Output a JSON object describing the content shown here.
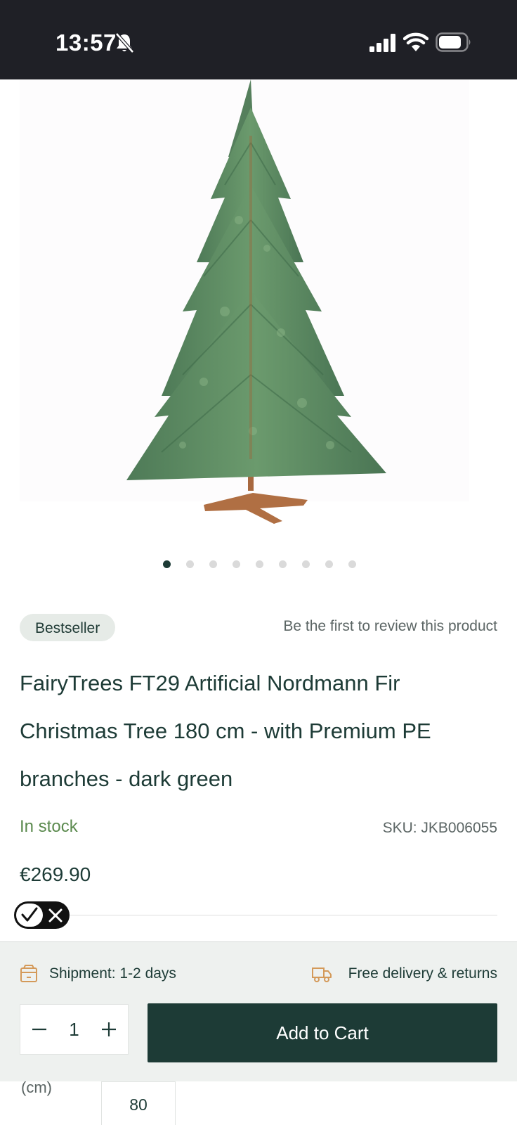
{
  "status_bar": {
    "time": "13:57",
    "icons": [
      "bell-slash-icon",
      "signal-icon",
      "wifi-icon",
      "battery-icon"
    ]
  },
  "gallery": {
    "image_description_icon": "christmas-tree-product-image",
    "dot_count": 9,
    "active_dot": 0
  },
  "product": {
    "badge": "Bestseller",
    "review_link": "Be the first to review this product",
    "title": "FairyTrees FT29 Artificial Nordmann Fir Christmas Tree 180 cm - with Premium PE branches - dark green",
    "stock": "In stock",
    "sku": "SKU: JKB006055",
    "price": "€269.90"
  },
  "purchase_bar": {
    "shipment": "Shipment: 1-2 days",
    "delivery": "Free delivery & returns",
    "quantity": "1",
    "add_to_cart": "Add to Cart"
  },
  "spec_table_peek": {
    "label": "(cm)",
    "value": "80"
  },
  "colors": {
    "brand_dark_green": "#1d3b36",
    "stock_green": "#5b8a4e",
    "accent_orange": "#d49a5a",
    "status_bar": "#1f2026"
  }
}
